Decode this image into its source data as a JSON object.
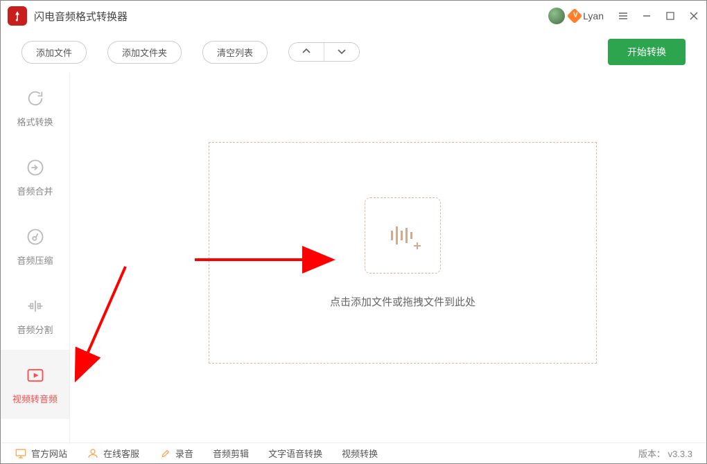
{
  "header": {
    "app_title": "闪电音频格式转换器",
    "username": "Lyan"
  },
  "toolbar": {
    "add_file": "添加文件",
    "add_folder": "添加文件夹",
    "clear_list": "清空列表",
    "start_convert": "开始转换"
  },
  "sidebar": {
    "items": [
      {
        "label": "格式转换"
      },
      {
        "label": "音频合并"
      },
      {
        "label": "音频压缩"
      },
      {
        "label": "音频分割"
      },
      {
        "label": "视频转音频"
      }
    ]
  },
  "dropzone": {
    "text": "点击添加文件或拖拽文件到此处"
  },
  "footer": {
    "official_site": "官方网站",
    "online_support": "在线客服",
    "record": "录音",
    "audio_edit": "音频剪辑",
    "tts": "文字语音转换",
    "video_convert": "视频转换",
    "version": "版本： v3.3.3"
  }
}
